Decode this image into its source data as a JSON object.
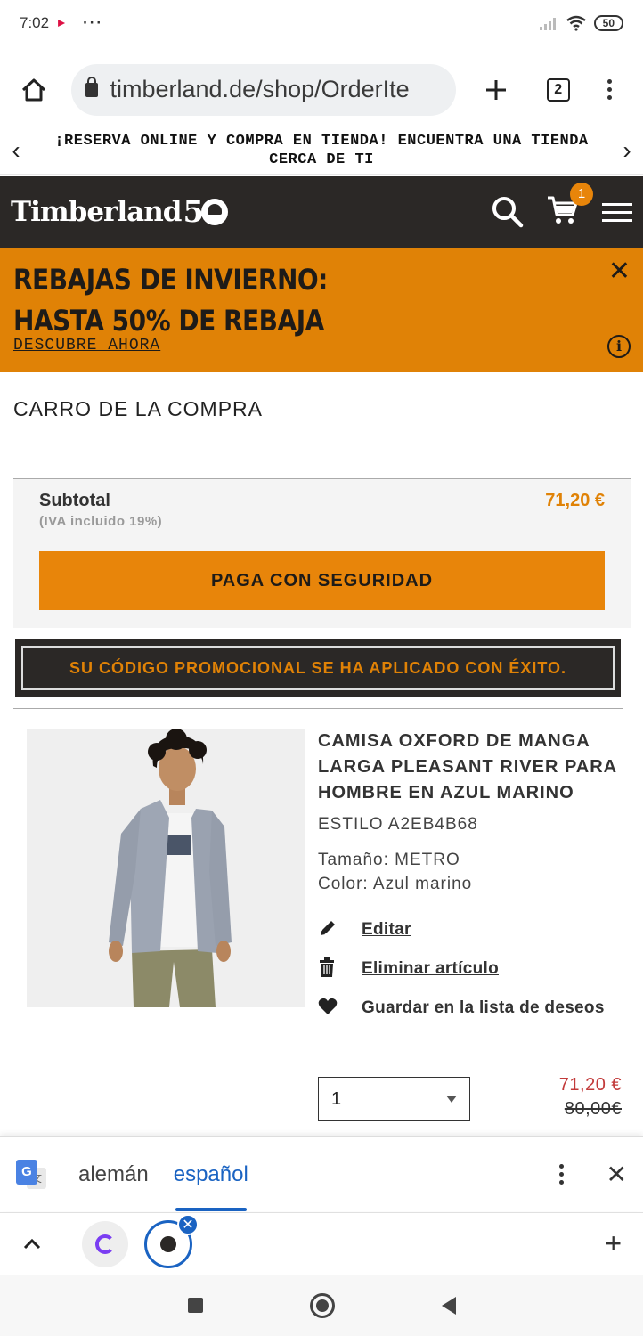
{
  "status_bar": {
    "time": "7:02",
    "more": "···",
    "battery": "50"
  },
  "browser": {
    "url": "timberland.de/shop/OrderIte",
    "tab_count": "2"
  },
  "reserve_banner": {
    "text": "¡RESERVA ONLINE Y COMPRA EN TIENDA! ENCUENTRA UNA TIENDA CERCA DE TI"
  },
  "header": {
    "logo": "Timberland",
    "logo_number": "5",
    "cart_count": "1"
  },
  "sale_banner": {
    "line1": "REBAJAS DE INVIERNO:",
    "line2": "HASTA 50% DE REBAJA",
    "link": "DESCUBRE AHORA",
    "info_glyph": "i"
  },
  "cart": {
    "title": "CARRO DE LA COMPRA",
    "subtotal_label": "Subtotal",
    "subtotal_note": "(IVA incluido 19%)",
    "subtotal_amount": "71,20 €",
    "pay_button": "PAGA CON SEGURIDAD",
    "promo_message": "SU CÓDIGO PROMOCIONAL SE HA APLICADO CON ÉXITO."
  },
  "product": {
    "name": "CAMISA OXFORD DE MANGA LARGA PLEASANT RIVER PARA HOMBRE EN AZUL MARINO",
    "style": "ESTILO A2EB4B68",
    "size_label": "Tamaño:",
    "size_value": "METRO",
    "color_label": "Color:",
    "color_value": "Azul marino",
    "actions": {
      "edit": "Editar",
      "remove": "Eliminar artículo",
      "wishlist": "Guardar en la lista de deseos"
    },
    "quantity": "1",
    "price_now": "71,20 €",
    "price_was": "80,00€"
  },
  "translate_bar": {
    "lang_source": "alemán",
    "lang_target": "español"
  },
  "colors": {
    "brand_dark": "#2b2826",
    "accent_orange": "#e8850a",
    "sale_red": "#c23a3a",
    "chrome_blue": "#1a63c2"
  },
  "icons": [
    "home-icon",
    "lock-icon",
    "plus-icon",
    "tab-switcher-icon",
    "kebab-menu-icon",
    "search-icon",
    "cart-icon",
    "hamburger-icon",
    "close-icon",
    "info-icon",
    "pencil-icon",
    "trash-icon",
    "heart-icon",
    "google-translate-icon",
    "chevron-up-icon"
  ]
}
